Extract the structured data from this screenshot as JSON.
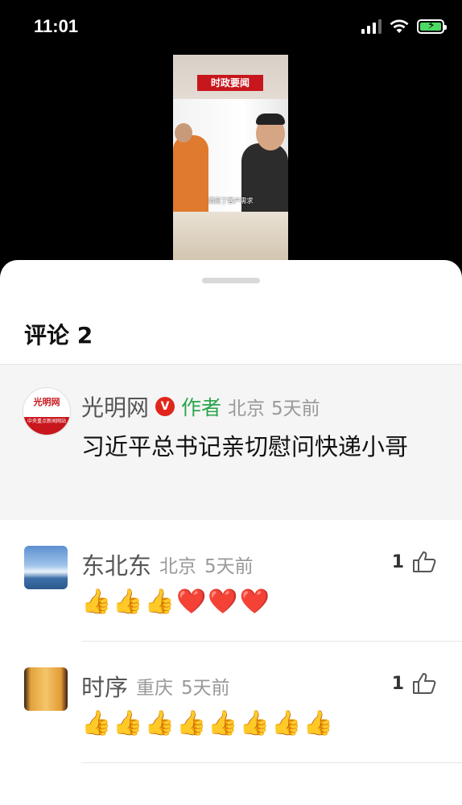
{
  "status_bar": {
    "time": "11:01"
  },
  "video": {
    "banner": "时政要闻",
    "caption": "满足了客户需求"
  },
  "comments_sheet": {
    "title": "评论 2",
    "author_comment": {
      "avatar_text": "光明网",
      "avatar_sub": "中央重点新闻网站",
      "name": "光明网",
      "badge": "V",
      "author_tag": "作者",
      "location": "北京",
      "time": "5天前",
      "text": "习近平总书记亲切慰问快递小哥"
    },
    "comments": [
      {
        "name": "东北东",
        "location": "北京",
        "time": "5天前",
        "likes": "1",
        "text": "👍👍👍❤️❤️❤️"
      },
      {
        "name": "时序",
        "location": "重庆",
        "time": "5天前",
        "likes": "1",
        "text": "👍👍👍👍👍👍👍👍"
      }
    ]
  }
}
